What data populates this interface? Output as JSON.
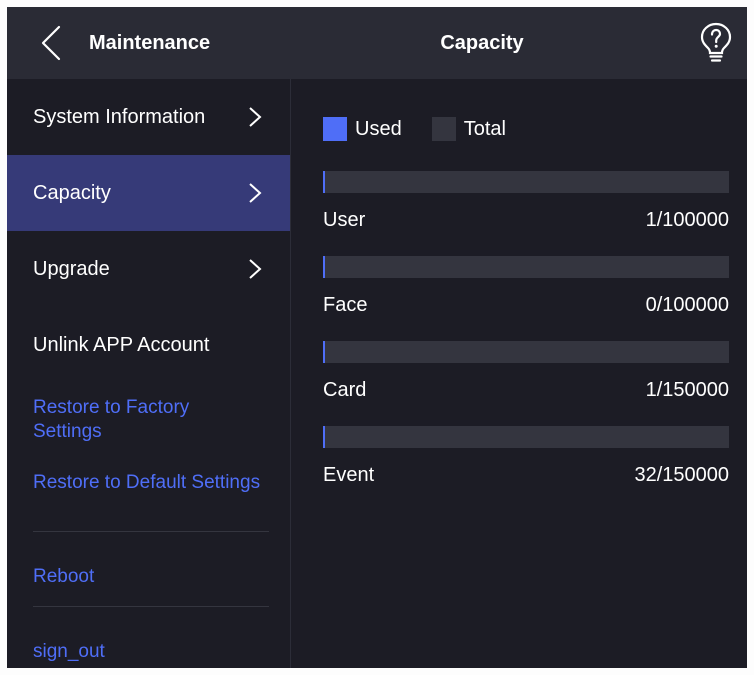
{
  "header": {
    "section_title": "Maintenance",
    "page_title": "Capacity"
  },
  "sidebar": {
    "items": [
      {
        "label": "System Information"
      },
      {
        "label": "Capacity"
      },
      {
        "label": "Upgrade"
      },
      {
        "label": "Unlink APP Account"
      }
    ],
    "links": [
      {
        "label": "Restore to Factory Settings"
      },
      {
        "label": "Restore to Default Settings"
      },
      {
        "label": "Reboot"
      },
      {
        "label": "sign_out"
      }
    ]
  },
  "legend": {
    "used_label": "Used",
    "total_label": "Total",
    "used_color": "#4f6ef7",
    "total_color": "#34353f"
  },
  "capacity": [
    {
      "label": "User",
      "value": "1/100000",
      "used": 1,
      "total": 100000
    },
    {
      "label": "Face",
      "value": "0/100000",
      "used": 0,
      "total": 100000
    },
    {
      "label": "Card",
      "value": "1/150000",
      "used": 1,
      "total": 150000
    },
    {
      "label": "Event",
      "value": "32/150000",
      "used": 32,
      "total": 150000
    }
  ],
  "icons": {
    "back": "chevron-left-icon",
    "help": "lightbulb-question-icon",
    "chevron": "chevron-right-icon"
  },
  "colors": {
    "accent": "#4f6ef7",
    "active_item": "#363a78",
    "header_bg": "#2a2b35",
    "bg": "#1c1c25"
  }
}
